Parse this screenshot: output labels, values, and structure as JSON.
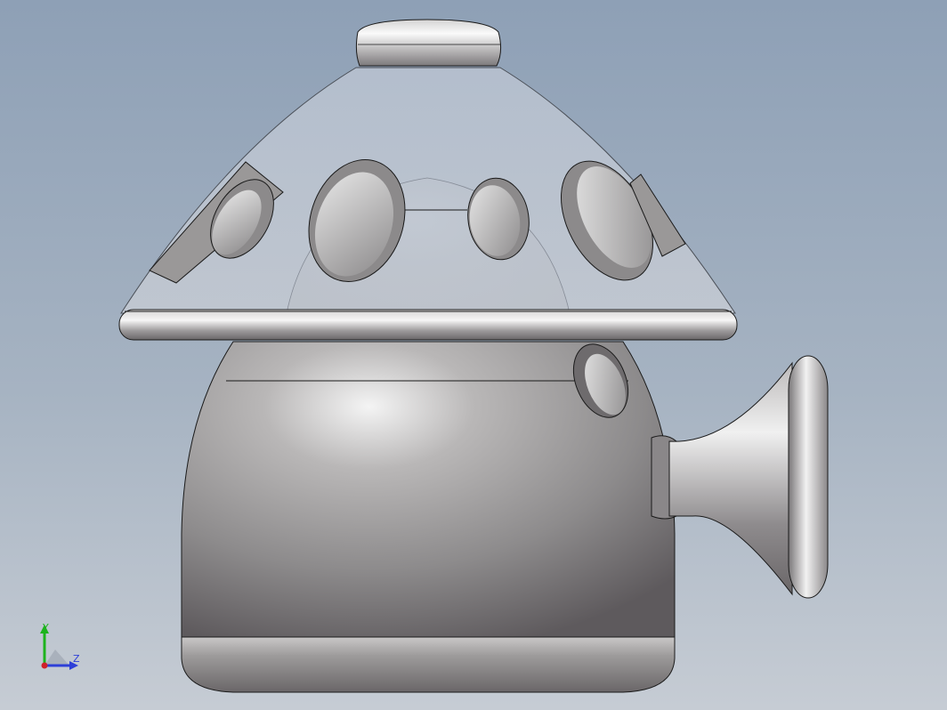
{
  "viewport": {
    "background_top": "#8ea0b6",
    "background_bottom": "#c6ccd4"
  },
  "model": {
    "body_color": "#9a9898",
    "cap_glass_color": "#b8c2d0",
    "edge_color": "#1a1a1a"
  },
  "triad": {
    "y_label": "Y",
    "z_label": "Z",
    "y_color": "#1db31d",
    "z_color": "#2d3fd8",
    "origin_color": "#d0202a"
  }
}
